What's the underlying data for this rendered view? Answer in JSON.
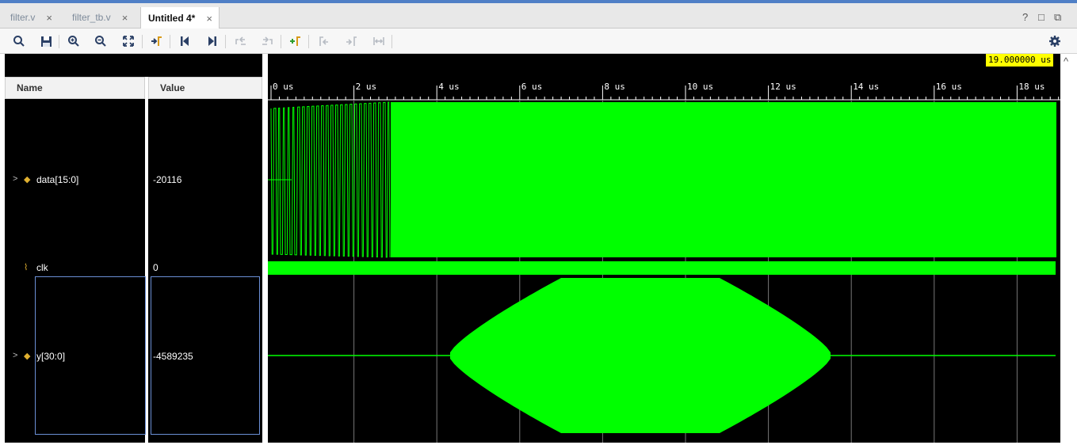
{
  "tabs": [
    {
      "label": "filter.v",
      "close": "×"
    },
    {
      "label": "filter_tb.v",
      "close": "×"
    },
    {
      "label": "Untitled 4*",
      "close": "×"
    }
  ],
  "window_controls": {
    "help": "?",
    "restore": "□",
    "popout": "⧉"
  },
  "toolbar": {
    "search": "search-icon",
    "save": "save-icon",
    "zoom_in": "zoom-in-icon",
    "zoom_out": "zoom-out-icon",
    "zoom_fit": "zoom-fit-icon",
    "settings": "gear-icon"
  },
  "columns": {
    "name": "Name",
    "value": "Value"
  },
  "signals": [
    {
      "name": "data[15:0]",
      "value": "-20116",
      "type": "bus",
      "expandable": true
    },
    {
      "name": "clk",
      "value": "0",
      "type": "bit",
      "expandable": false
    },
    {
      "name": "y[30:0]",
      "value": "-4589235",
      "type": "bus",
      "expandable": true
    }
  ],
  "cursor": {
    "label": "19.000000 us",
    "time_us": 19.0
  },
  "timeline": {
    "unit": "us",
    "ticks": [
      "0 us",
      "2 us",
      "4 us",
      "6 us",
      "8 us",
      "10 us",
      "12 us",
      "14 us",
      "16 us",
      "18 us"
    ],
    "range_us": [
      0,
      19.0
    ]
  },
  "colors": {
    "waveform": "#00ff00",
    "background": "#000000",
    "cursor_label": "#ffff00",
    "tab_accent": "#4f7fc6"
  }
}
